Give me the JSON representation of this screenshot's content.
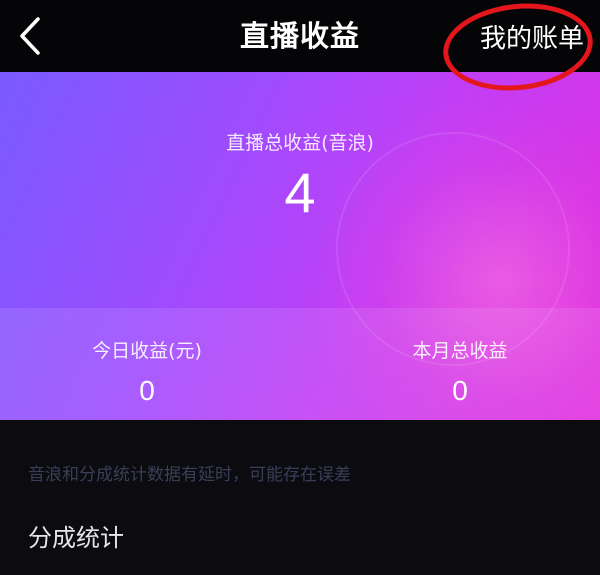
{
  "header": {
    "back_icon": "chevron-left-icon",
    "title": "直播收益",
    "bill_link": "我的账单"
  },
  "card": {
    "total_label": "直播总收益(音浪)",
    "total_value": "4",
    "today_label": "今日收益(元)",
    "today_value": "0",
    "month_label": "本月总收益",
    "month_value": "0"
  },
  "notice": "音浪和分成统计数据有延时，可能存在误差",
  "section_title": "分成统计",
  "colors": {
    "header_bg": "#050507",
    "page_bg": "#0b0b10",
    "card_gradient_start": "#7a5bff",
    "card_gradient_end": "#e12dde",
    "annotation_red": "#e3161c",
    "notice_text": "#3a3f57"
  }
}
